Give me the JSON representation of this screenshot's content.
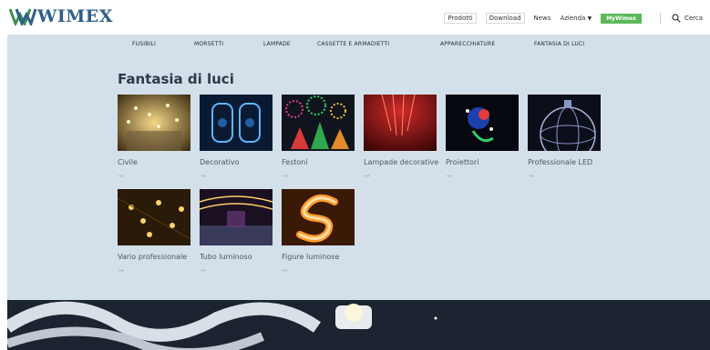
{
  "brand": {
    "name": "WIMEX"
  },
  "topnav": {
    "products": "Prodotti",
    "download": "Download",
    "news": "News",
    "company": "Azienda",
    "my": "MyWimex",
    "search": "Cerca"
  },
  "categories": [
    "FUSIBILI",
    "MORSETTI",
    "LAMPADE",
    "CASSETTE E ARMADIETTI",
    "APPARECCHIATURE",
    "FANTASIA DI LUCI"
  ],
  "section": {
    "title": "Fantasia di luci"
  },
  "products": [
    {
      "label": "Civile",
      "arrow": "→"
    },
    {
      "label": "Decorativo",
      "arrow": "→"
    },
    {
      "label": "Festoni",
      "arrow": "→"
    },
    {
      "label": "Lampade decorative",
      "arrow": "→"
    },
    {
      "label": "Proiettori",
      "arrow": "→"
    },
    {
      "label": "Professionale LED",
      "arrow": "→"
    },
    {
      "label": "Vario professionale",
      "arrow": "→"
    },
    {
      "label": "Tubo luminoso",
      "arrow": "→"
    },
    {
      "label": "Figure luminose",
      "arrow": "→"
    }
  ],
  "colors": {
    "brand": "#2f5f8a",
    "panel": "#d3e0ea",
    "accent_green": "#5cb85c",
    "arrow": "#9fb7c9"
  }
}
